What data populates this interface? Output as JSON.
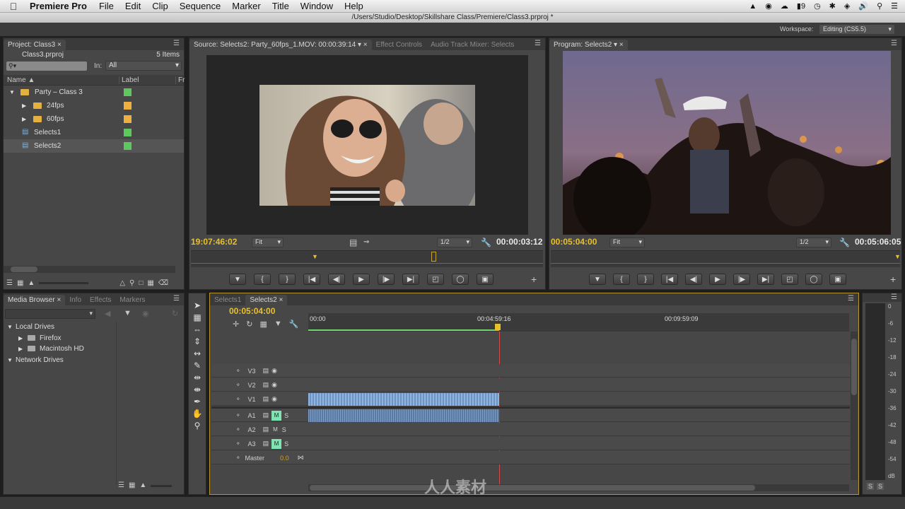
{
  "menubar": {
    "app_name": "Premiere Pro",
    "items": [
      "File",
      "Edit",
      "Clip",
      "Sequence",
      "Marker",
      "Title",
      "Window",
      "Help"
    ],
    "status": {
      "battery_count": "9",
      "clock_icon": "clock-icon"
    }
  },
  "window": {
    "title": "/Users/Studio/Desktop/Skillshare Class/Premiere/Class3.prproj *"
  },
  "workspace": {
    "label": "Workspace:",
    "value": "Editing (CS5.5)"
  },
  "project": {
    "tab": "Project: Class3",
    "file": "Class3.prproj",
    "items_count": "5 Items",
    "in_label": "In:",
    "in_value": "All",
    "col_name": "Name",
    "col_label": "Label",
    "col_fr": "Fr",
    "rows": [
      {
        "name": "Party – Class 3",
        "color": "#5ec85e"
      },
      {
        "name": "24fps",
        "color": "#f0b040"
      },
      {
        "name": "60fps",
        "color": "#f0b040"
      },
      {
        "name": "Selects1",
        "color": "#5ec85e"
      },
      {
        "name": "Selects2",
        "color": "#5ec85e"
      }
    ]
  },
  "source": {
    "tab": "Source: Selects2: Party_60fps_1.MOV: 00:00:39:14",
    "tab2": "Effect Controls",
    "tab3": "Audio Track Mixer: Selects",
    "tc_left": "19:07:46:02",
    "fit": "Fit",
    "res": "1/2",
    "tc_right": "00:00:03:12"
  },
  "program": {
    "tab": "Program: Selects2",
    "tc_left": "00:05:04:00",
    "fit": "Fit",
    "res": "1/2",
    "tc_right": "00:05:06:05"
  },
  "media": {
    "tabs": [
      "Media Browser",
      "Info",
      "Effects",
      "Markers"
    ],
    "local": "Local Drives",
    "drives": [
      "Firefox",
      "Macintosh HD"
    ],
    "network": "Network Drives"
  },
  "timeline": {
    "tabs": [
      "Selects1",
      "Selects2"
    ],
    "tc": "00:05:04:00",
    "ruler": [
      "00:00",
      "00:04:59:16",
      "00:09:59:09"
    ],
    "video_tracks": [
      "V3",
      "V2",
      "V1"
    ],
    "audio_tracks": [
      "A1",
      "A2",
      "A3"
    ],
    "master_label": "Master",
    "master_val": "0.0"
  },
  "meter": {
    "labels": [
      "0",
      "-6",
      "-12",
      "-18",
      "-24",
      "-30",
      "-36",
      "-42",
      "-48",
      "-54",
      "dB"
    ],
    "solo": "S"
  },
  "watermark": "人人素材"
}
